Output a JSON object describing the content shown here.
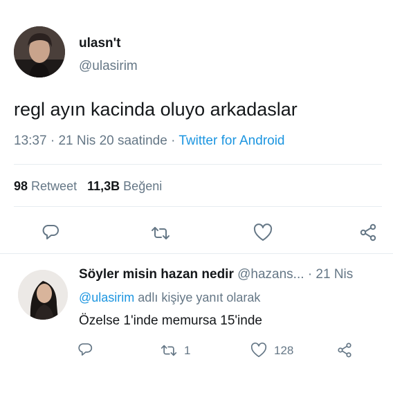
{
  "tweet": {
    "display_name": "ulasn't",
    "handle": "@ulasirim",
    "text": "regl ayın kacinda oluyo arkadaslar",
    "time": "13:37",
    "sep1": "·",
    "date": "21 Nis 20 saatinde",
    "sep2": "·",
    "source": "Twitter for Android",
    "retweets": "98",
    "retweets_label": "Retweet",
    "likes": "11,3B",
    "likes_label": "Beğeni"
  },
  "reply": {
    "display_name": "Söyler misin hazan nedir",
    "handle": "@hazans...",
    "date": "· 21 Nis",
    "reply_to_handle": "@ulasirim",
    "reply_to_suffix": "adlı kişiye yanıt olarak",
    "text": "Özelse 1'inde memursa 15'inde",
    "retweet_count": "1",
    "like_count": "128"
  },
  "colors": {
    "link": "#1b95e0",
    "secondary": "#657786",
    "icon": "#657786",
    "divider": "#e6ecf0"
  },
  "icons": [
    "reply-icon",
    "retweet-icon",
    "like-icon",
    "share-icon"
  ]
}
